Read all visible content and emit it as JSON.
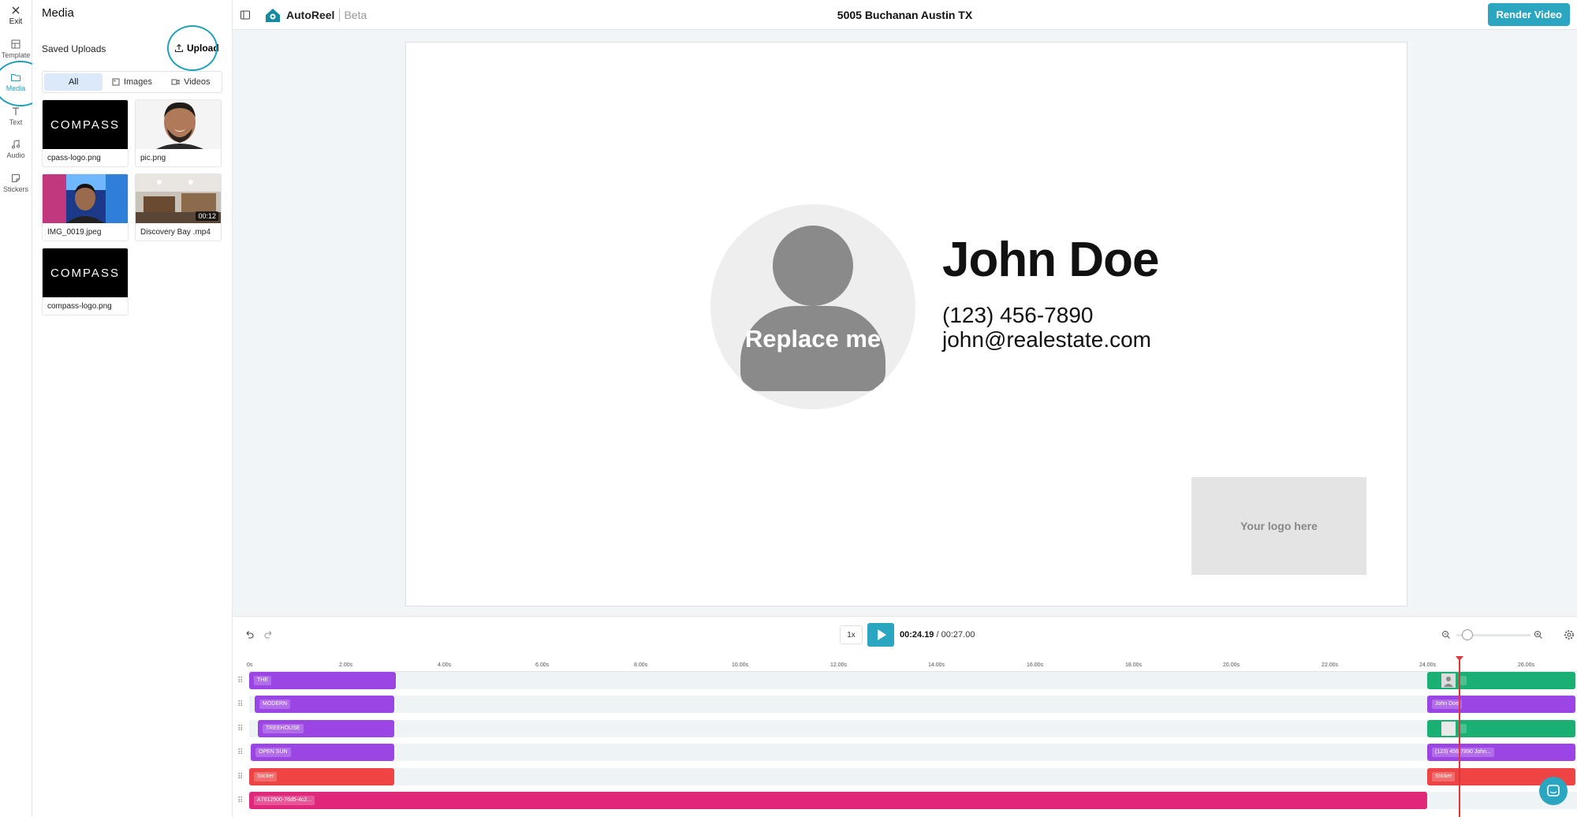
{
  "rail": {
    "items": [
      {
        "label": "Exit",
        "icon": "close-icon"
      },
      {
        "label": "Template",
        "icon": "template-icon"
      },
      {
        "label": "Media",
        "icon": "folder-icon"
      },
      {
        "label": "Text",
        "icon": "text-icon"
      },
      {
        "label": "Audio",
        "icon": "music-icon"
      },
      {
        "label": "Stickers",
        "icon": "sticker-icon"
      }
    ]
  },
  "panel": {
    "title": "Media",
    "saved_label": "Saved Uploads",
    "upload_label": "Upload",
    "tabs": [
      {
        "label": "All"
      },
      {
        "label": "Images"
      },
      {
        "label": "Videos"
      }
    ],
    "files": [
      {
        "name": "cpass-logo.png",
        "thumb_text": "COMPASS"
      },
      {
        "name": "pic.png"
      },
      {
        "name": "IMG_0019.jpeg"
      },
      {
        "name": "Discovery Bay .mp4",
        "duration": "00:12"
      },
      {
        "name": "compass-logo.png",
        "thumb_text": "COMPASS"
      }
    ]
  },
  "header": {
    "brand": "AutoReel",
    "beta": "Beta",
    "project_title": "5005 Buchanan Austin TX",
    "render_label": "Render Video"
  },
  "canvas": {
    "avatar_text": "Replace me",
    "name": "John Doe",
    "phone": "(123) 456-7890",
    "email": "john@realestate.com",
    "logo_placeholder": "Your logo here"
  },
  "timeline": {
    "speed": "1x",
    "current_time": "00:24.19",
    "separator": "/",
    "total_time": "00:27.00",
    "ruler": [
      "0s",
      "2.00s",
      "4.00s",
      "6.00s",
      "8.00s",
      "10.00s",
      "12.00s",
      "14.00s",
      "16.00s",
      "18.00s",
      "20.00s",
      "22.00s",
      "24.00s",
      "26.00s"
    ],
    "tracks": [
      {
        "clips": [
          {
            "label": "THE",
            "kind": "text",
            "color": "#9b45e4"
          },
          {
            "label": "",
            "kind": "image",
            "color": "#1aaf73"
          }
        ]
      },
      {
        "clips": [
          {
            "label": "MODERN",
            "kind": "text",
            "color": "#9b45e4"
          },
          {
            "label": "John Doe",
            "kind": "text",
            "color": "#9b45e4"
          }
        ]
      },
      {
        "clips": [
          {
            "label": "TREEHOUSE",
            "kind": "text",
            "color": "#9b45e4"
          },
          {
            "label": "",
            "kind": "shape",
            "color": "#1aaf73"
          }
        ]
      },
      {
        "clips": [
          {
            "label": "OPEN SUN",
            "kind": "text",
            "color": "#9b45e4"
          },
          {
            "label": "(123) 456-7890 John...",
            "kind": "text",
            "color": "#9b45e4"
          }
        ]
      },
      {
        "clips": [
          {
            "label": "Sticker",
            "kind": "sticker",
            "color": "#ef4444"
          },
          {
            "label": "Sticker",
            "kind": "sticker",
            "color": "#ef4444"
          }
        ]
      },
      {
        "clips": [
          {
            "label": "A7812900-76d5-4c2...",
            "kind": "video",
            "color": "#e0287a"
          }
        ]
      }
    ]
  },
  "colors": {
    "accent": "#2aa6c0",
    "text_clip": "#9b45e4",
    "image_clip": "#1aaf73",
    "sticker_clip": "#ef4444",
    "video_clip": "#e0287a",
    "playhead": "#e0353b"
  }
}
